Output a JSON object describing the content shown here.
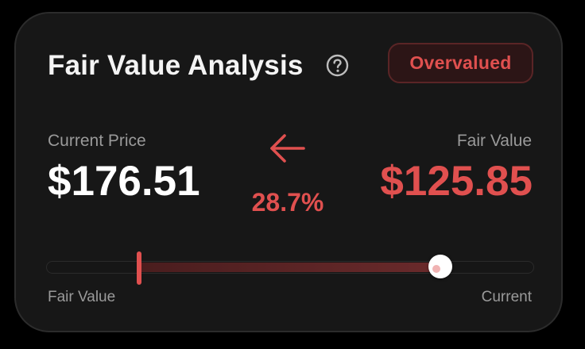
{
  "header": {
    "title": "Fair Value Analysis",
    "help_icon": "question-circle-icon",
    "status_badge": "Overvalued"
  },
  "current_price": {
    "label": "Current Price",
    "value": "$176.51"
  },
  "difference": {
    "direction_icon": "arrow-left-icon",
    "percent": "28.7%"
  },
  "fair_value": {
    "label": "Fair Value",
    "value": "$125.85"
  },
  "range_bar": {
    "left_label": "Fair Value",
    "right_label": "Current",
    "fair_value_position_fraction": 0.19,
    "current_position_fraction": 0.81
  },
  "colors": {
    "accent_red": "#e0504f",
    "card_background": "#171717",
    "text_primary": "#ffffff",
    "text_secondary": "#9a9a9a"
  }
}
